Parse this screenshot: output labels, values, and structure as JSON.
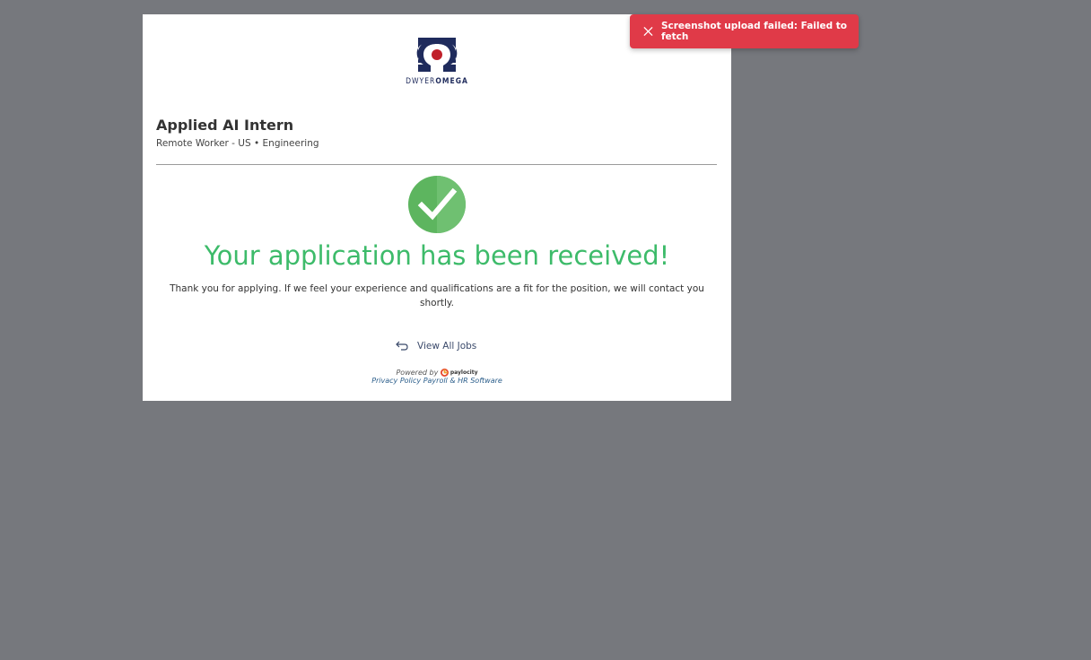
{
  "logo": {
    "icon": "omega-logo-icon",
    "text_part1": "DWYER",
    "text_part2": "OMEGA"
  },
  "job": {
    "title": "Applied AI Intern",
    "meta": "Remote Worker - US • Engineering"
  },
  "confirmation": {
    "icon": "check-circle-icon",
    "headline": "Your application has been received!",
    "message": "Thank you for applying. If we feel your experience and qualifications are a fit for the position, we will contact you shortly."
  },
  "nav": {
    "view_all_jobs": "View All Jobs",
    "icon": "back-arrow-icon"
  },
  "footer": {
    "powered_by": "Powered by",
    "brand": "paylocity",
    "privacy_policy": "Privacy Policy",
    "payroll": "Payroll & HR Software"
  },
  "toast": {
    "message": "Screenshot upload failed: Failed to fetch",
    "icon": "close-icon"
  },
  "colors": {
    "success": "#3dbb6a",
    "toast": "#e03a48",
    "backdrop": "#76787d",
    "logo_navy": "#1f2b5c",
    "logo_red": "#c0202a"
  }
}
